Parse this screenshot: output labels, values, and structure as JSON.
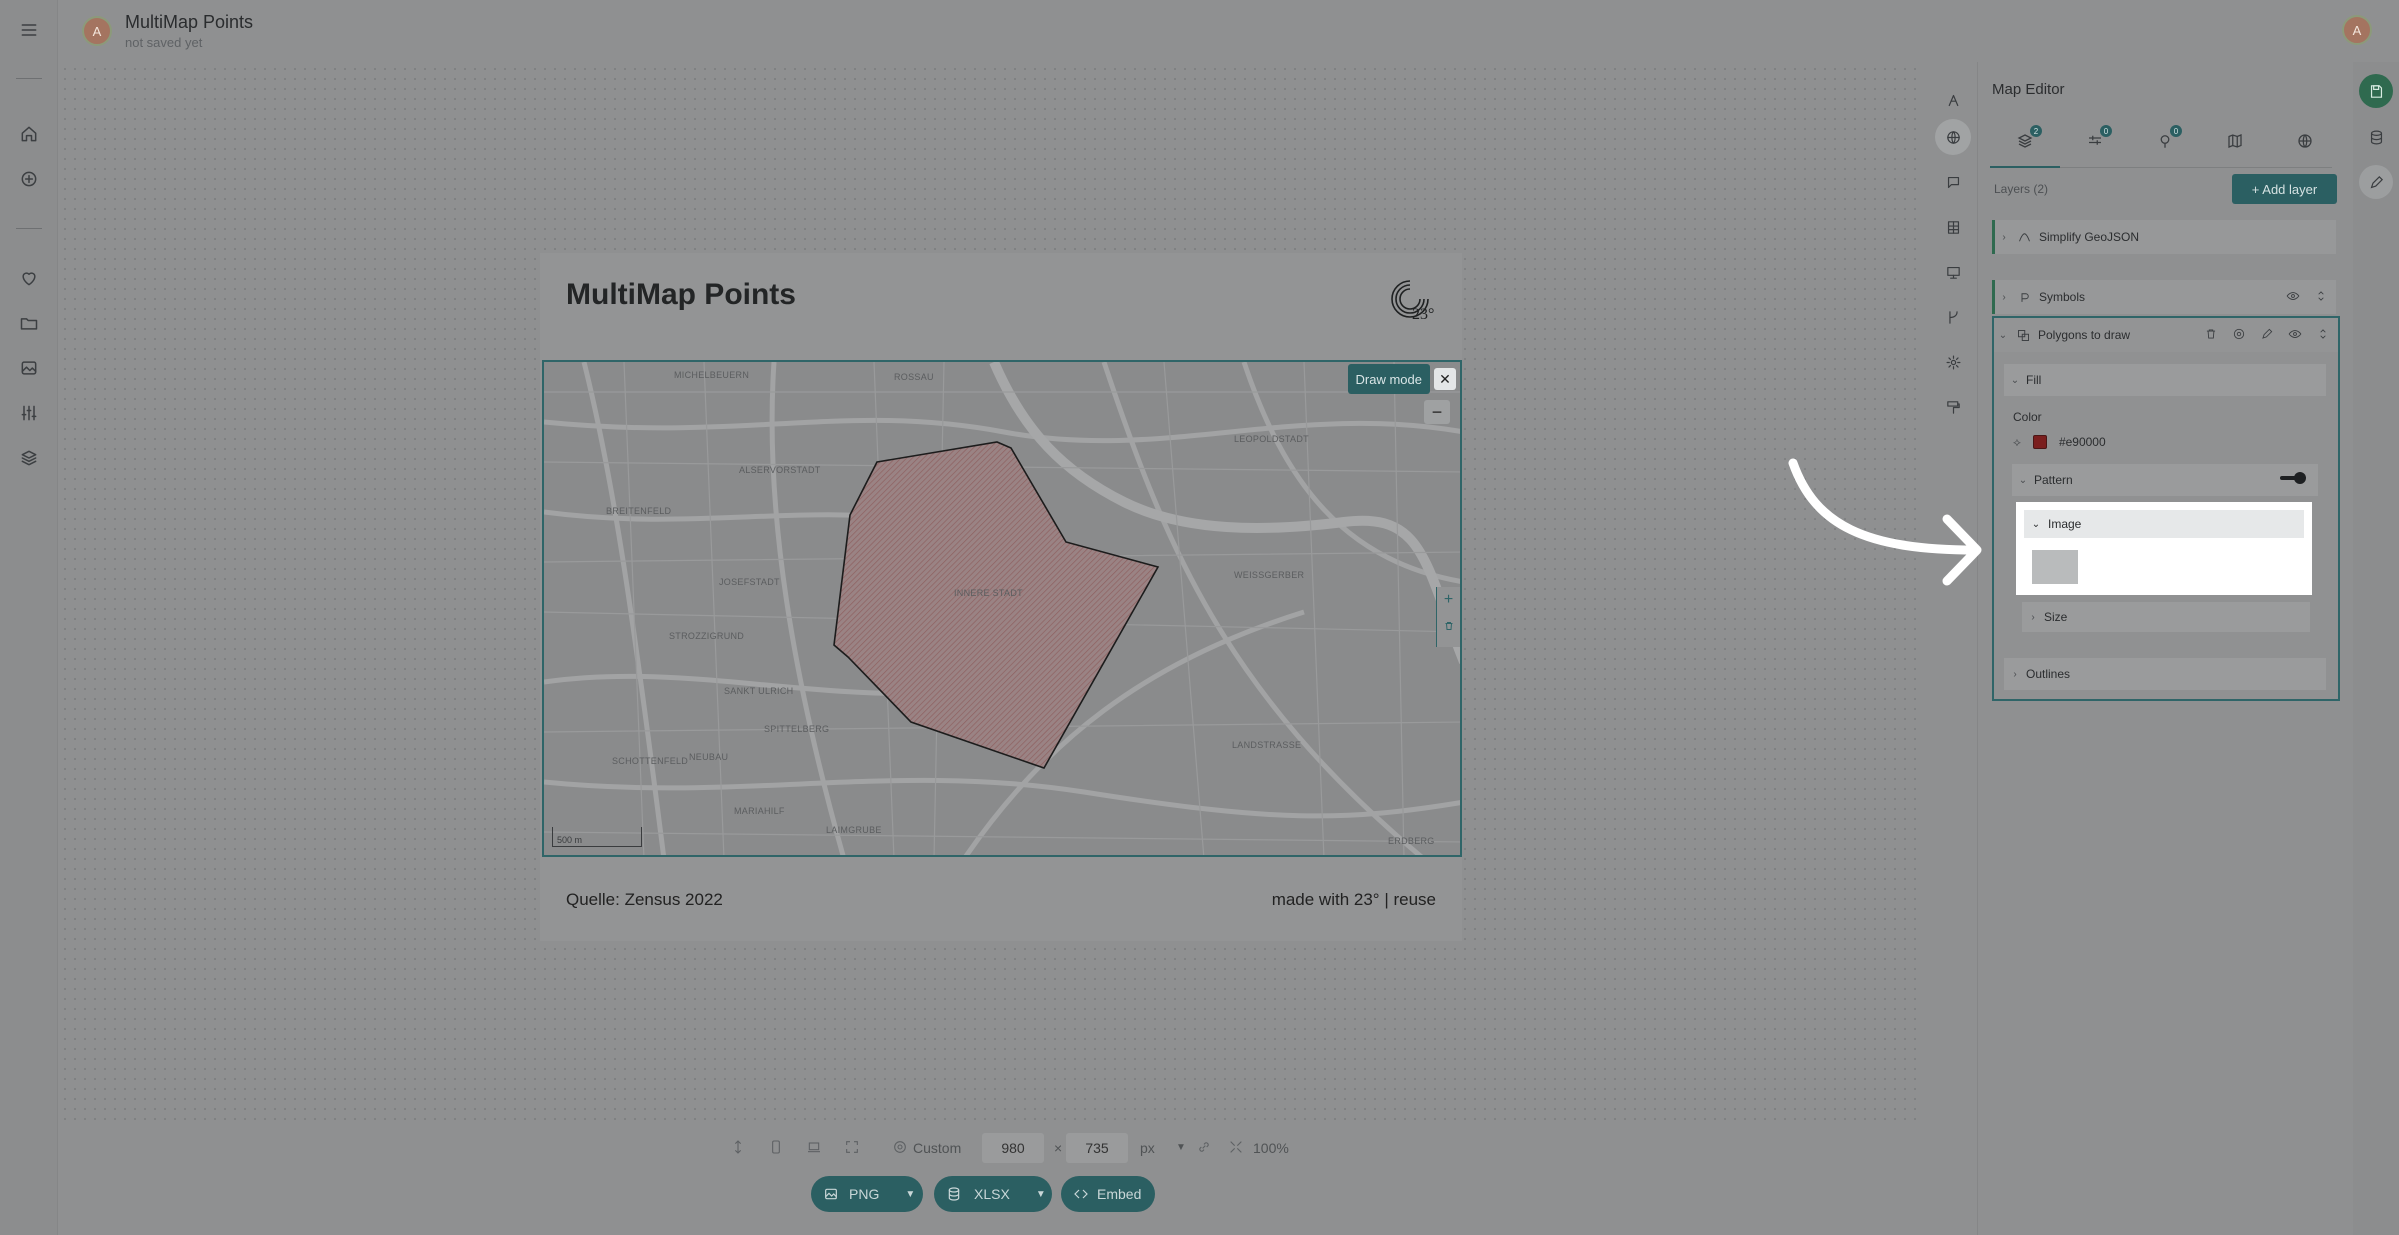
{
  "header": {
    "avatar_initial": "A",
    "title": "MultiMap Points",
    "subtitle": "not saved yet"
  },
  "left_nav": {
    "icons": [
      "menu-icon",
      "home-icon",
      "add-circle-icon",
      "heart-icon",
      "folder-icon",
      "image-icon",
      "sliders-icon",
      "layers-icon"
    ]
  },
  "card": {
    "title": "MultiMap Points",
    "logo_text": "23°",
    "source": "Quelle: Zensus 2022",
    "made_with": "made with 23° | reuse"
  },
  "map": {
    "draw_mode_label": "Draw mode",
    "close_glyph": "✕",
    "zoom_out_glyph": "−",
    "add_glyph": "+",
    "trash_glyph": "🗑",
    "scale_label": "500 m",
    "labels": [
      {
        "text": "MICHELBEUERN"
      },
      {
        "text": "ROSSAU"
      },
      {
        "text": "LEOPOLDSTADT"
      },
      {
        "text": "ALSERVORSTADT"
      },
      {
        "text": "BREITENFELD"
      },
      {
        "text": "JOSEFSTADT"
      },
      {
        "text": "INNERE STADT"
      },
      {
        "text": "WEISSGERBER"
      },
      {
        "text": "STROZZIGRUND"
      },
      {
        "text": "SANKT ULRICH"
      },
      {
        "text": "SPITTELBERG"
      },
      {
        "text": "SCHOTTENFELD"
      },
      {
        "text": "NEUBAU"
      },
      {
        "text": "MARIAHILF"
      },
      {
        "text": "LAIMGRUBE"
      },
      {
        "text": "LANDSTRASSE"
      },
      {
        "text": "ERDBERG"
      }
    ],
    "polygon_color": "#e90000"
  },
  "size_bar": {
    "preset": "Custom",
    "width": "980",
    "times": "×",
    "height": "735",
    "unit": "px",
    "zoom": "100%"
  },
  "export": {
    "png": "PNG",
    "xlsx": "XLSX",
    "embed": "Embed"
  },
  "editor": {
    "title": "Map Editor",
    "tabs": [
      {
        "icon": "layers-icon",
        "badge": "2"
      },
      {
        "icon": "filters-icon",
        "badge": "0"
      },
      {
        "icon": "pins-icon",
        "badge": "0"
      },
      {
        "icon": "map-icon",
        "badge": ""
      },
      {
        "icon": "globe-icon",
        "badge": ""
      }
    ],
    "layers_count": "Layers (2)",
    "add_layer": "+ Add layer",
    "layers": [
      {
        "name": "Simplify GeoJSON"
      },
      {
        "name": "Symbols"
      },
      {
        "name": "Polygons to draw"
      }
    ],
    "fill": {
      "section": "Fill",
      "color_label": "Color",
      "color_value": "#e90000",
      "pattern": "Pattern",
      "image": "Image",
      "size": "Size"
    },
    "outlines": "Outlines"
  }
}
